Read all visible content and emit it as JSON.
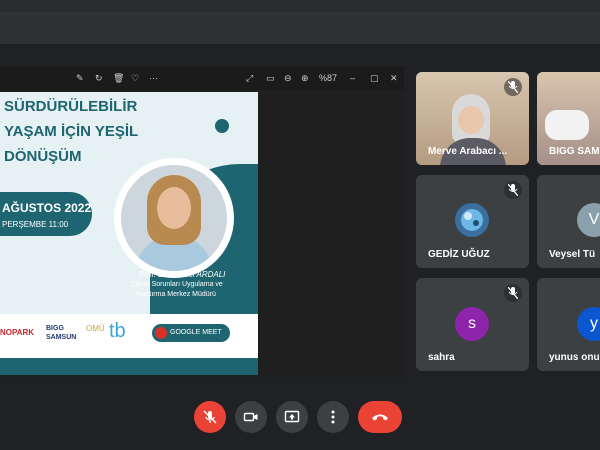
{
  "presentation": {
    "toolbar": {
      "zoom": "%87"
    },
    "slide": {
      "title_line1": "SÜRDÜRÜLEBİLİR",
      "title_line2": "YAŞAM İÇİN YEŞİL",
      "title_line3": "DÖNÜŞÜM",
      "date": "AĞUSTOS 2022",
      "day_time": "PERŞEMBE 11:00",
      "speaker_name": "Prof. Dr. Yüksel ARDALI",
      "speaker_role_line1": "Çevre Sorunları Uygulama ve",
      "speaker_role_line2": "Araştırma Merkez Müdürü",
      "logos": {
        "technopark": "NOPARK",
        "bigg_line1": "BIGG",
        "bigg_line2": "SAMSUN",
        "omu": "OMÜ",
        "tb": "tb"
      },
      "meet_label": "GOOGLE MEET"
    }
  },
  "participants": [
    {
      "name": "Merve Arabacı ...",
      "muted": true,
      "video": true
    },
    {
      "name": "BIGG SAM",
      "muted": false,
      "video": true
    },
    {
      "name": "GEDİZ UĞUZ",
      "muted": true,
      "video": false,
      "avatar_color": "#3a6f9e"
    },
    {
      "name": "Veysel Tü",
      "muted": false,
      "video": false,
      "initial": "V",
      "avatar_color": "#8aa0aa"
    },
    {
      "name": "sahra",
      "muted": true,
      "video": false,
      "initial": "s",
      "avatar_color": "#8e24aa"
    },
    {
      "name": "yunus onu",
      "muted": false,
      "video": false,
      "initial": "y",
      "avatar_color": "#0b57d0"
    }
  ],
  "controls": {
    "mic": "mic-off",
    "camera": "camera",
    "present": "present-screen",
    "more": "more-options",
    "leave": "leave-call"
  },
  "colors": {
    "accent_teal": "#1e6571",
    "end_call": "#ea4335",
    "tile_bg": "#3c4043"
  }
}
